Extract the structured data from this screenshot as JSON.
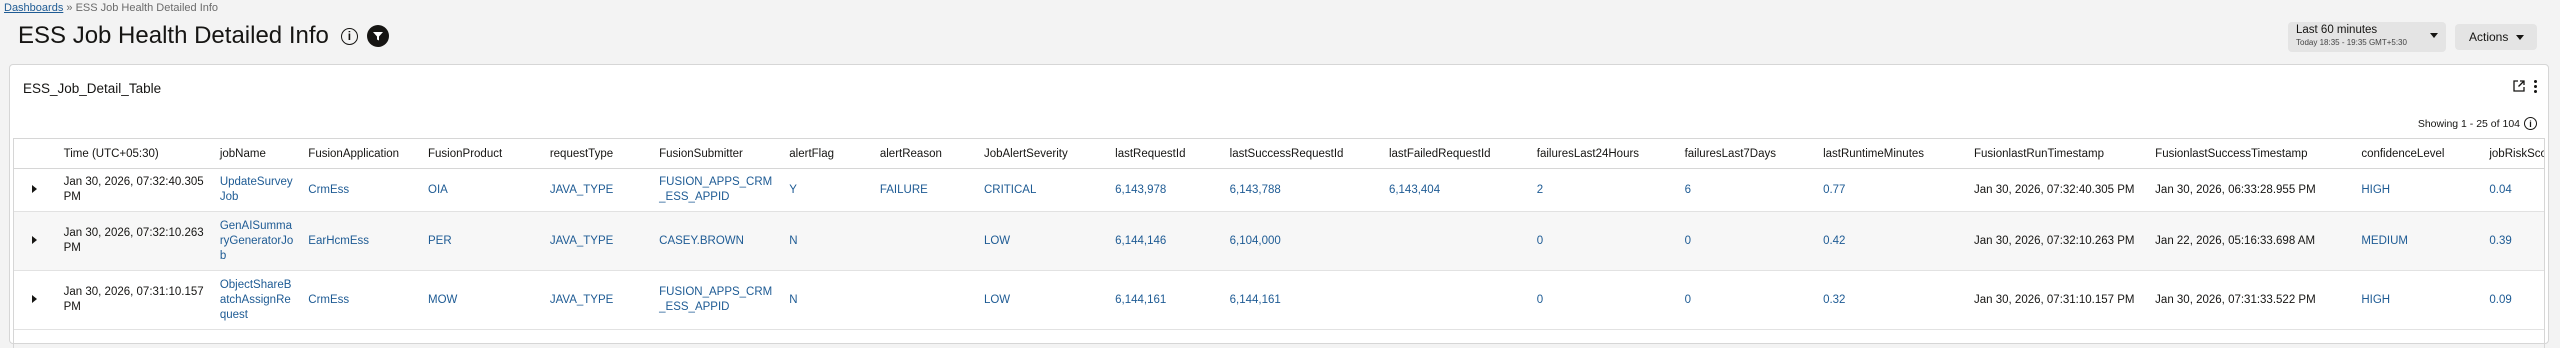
{
  "breadcrumb": {
    "root": "Dashboards",
    "separator": "»",
    "current": "ESS Job Health Detailed Info"
  },
  "page_title": "ESS Job Health Detailed Info",
  "icons": {
    "info": "info-icon",
    "filter": "filter-icon",
    "open_in_new": "open-in-new-icon",
    "more": "kebab-icon",
    "expand": "chevron-right-icon"
  },
  "time_picker": {
    "label": "Last 60 minutes",
    "sub": "Today 18:35 - 19:35 GMT+5:30"
  },
  "actions_label": "Actions",
  "panel": {
    "title": "ESS_Job_Detail_Table",
    "showing": "Showing 1 - 25 of 104"
  },
  "table": {
    "columns": [
      "Time (UTC+05:30)",
      "jobName",
      "FusionApplication",
      "FusionProduct",
      "requestType",
      "FusionSubmitter",
      "alertFlag",
      "alertReason",
      "JobAlertSeverity",
      "lastRequestId",
      "lastSuccessRequestId",
      "lastFailedRequestId",
      "failuresLast24Hours",
      "failuresLast7Days",
      "lastRuntimeMinutes",
      "FusionlastRunTimestamp",
      "FusionlastSuccessTimestamp",
      "confidenceLevel",
      "jobRiskScore"
    ],
    "rows": [
      [
        "Jan 30, 2026, 07:32:40.305 PM",
        "UpdateSurveyJob",
        "CrmEss",
        "OIA",
        "JAVA_TYPE",
        "FUSION_APPS_CRM_ESS_APPID",
        "Y",
        "FAILURE",
        "CRITICAL",
        "6,143,978",
        "6,143,788",
        "6,143,404",
        "2",
        "6",
        "0.77",
        "Jan 30, 2026, 07:32:40.305 PM",
        "Jan 30, 2026, 06:33:28.955 PM",
        "HIGH",
        "0.04"
      ],
      [
        "Jan 30, 2026, 07:32:10.263 PM",
        "GenAISummaryGeneratorJob",
        "EarHcmEss",
        "PER",
        "JAVA_TYPE",
        "CASEY.BROWN",
        "N",
        "",
        "LOW",
        "6,144,146",
        "6,104,000",
        "",
        "0",
        "0",
        "0.42",
        "Jan 30, 2026, 07:32:10.263 PM",
        "Jan 22, 2026, 05:16:33.698 AM",
        "MEDIUM",
        "0.39"
      ],
      [
        "Jan 30, 2026, 07:31:10.157 PM",
        "ObjectShareBatchAssignRequest",
        "CrmEss",
        "MOW",
        "JAVA_TYPE",
        "FUSION_APPS_CRM_ESS_APPID",
        "N",
        "",
        "LOW",
        "6,144,161",
        "6,144,161",
        "",
        "0",
        "0",
        "0.32",
        "Jan 30, 2026, 07:31:10.157 PM",
        "Jan 30, 2026, 07:31:33.522 PM",
        "HIGH",
        "0.09"
      ]
    ]
  }
}
